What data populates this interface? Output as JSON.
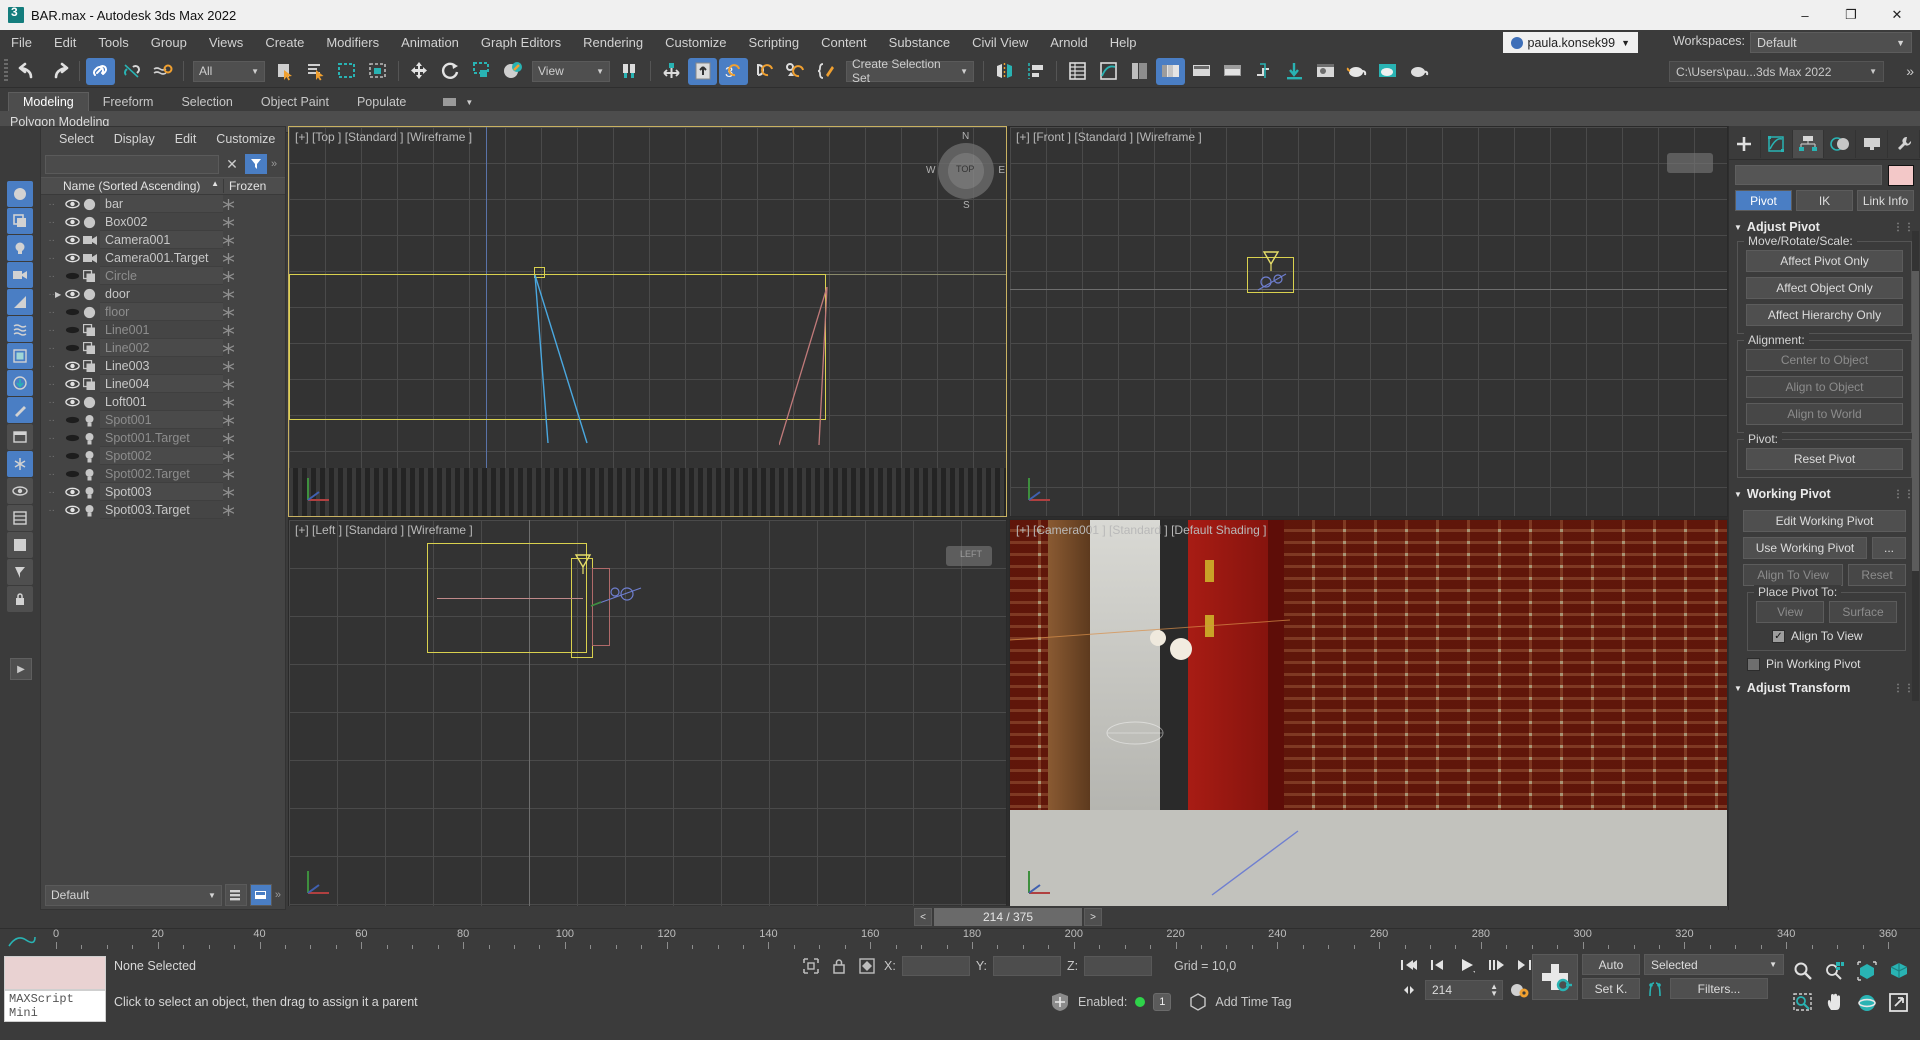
{
  "window": {
    "title": "BAR.max - Autodesk 3ds Max 2022",
    "app_icon": "max-logo-icon",
    "minimize": "–",
    "maximize": "❐",
    "close": "✕"
  },
  "menubar": {
    "items": [
      "File",
      "Edit",
      "Tools",
      "Group",
      "Views",
      "Create",
      "Modifiers",
      "Animation",
      "Graph Editors",
      "Rendering",
      "Customize",
      "Scripting",
      "Content",
      "Substance",
      "Civil View",
      "Arnold",
      "Help"
    ],
    "user": "paula.konsek99",
    "workspaces_label": "Workspaces:",
    "workspace_value": "Default"
  },
  "toolbar": {
    "selection_filter": "All",
    "reference_coordinate": "View",
    "selection_set": "Create Selection Set",
    "project_path": "C:\\Users\\pau...3ds Max 2022",
    "icons": [
      "undo-icon",
      "redo-icon",
      "select-and-link-icon",
      "unlink-selection-icon",
      "bind-to-space-warp-icon",
      "select-object-icon",
      "select-by-name-icon",
      "rectangular-selection-region-icon",
      "window-crossing-icon",
      "select-and-move-icon",
      "select-and-rotate-icon",
      "select-and-scale-icon",
      "select-and-place-icon",
      "use-pivot-point-center-icon",
      "select-and-manipulate-icon",
      "snaps-toggle-icon",
      "angle-snap-icon",
      "percent-snap-icon",
      "spinner-snap-icon",
      "edit-named-selection-sets-icon",
      "mirror-icon",
      "align-icon",
      "layer-explorer-icon",
      "scene-explorer-icon",
      "ribbon-icon",
      "curve-editor-icon",
      "schematic-view-icon",
      "project-folder-icon",
      "material-editor-icon",
      "render-setup-icon",
      "rendered-frame-window-icon",
      "render-production-icon"
    ]
  },
  "ribbon": {
    "tabs": [
      "Modeling",
      "Freeform",
      "Selection",
      "Object Paint",
      "Populate"
    ],
    "active_tab": "Modeling",
    "subtitle": "Polygon Modeling"
  },
  "explorer": {
    "menu": [
      "Select",
      "Display",
      "Edit",
      "Customize"
    ],
    "search_value": "",
    "clear_icon": "close-icon",
    "filter_icon": "funnel-icon",
    "columns": [
      "Name (Sorted Ascending)",
      "Frozen"
    ],
    "sort_arrow": "▲",
    "rows": [
      {
        "name": "bar",
        "type": "geometry",
        "visible": true,
        "hidden": false,
        "expandable": false
      },
      {
        "name": "Box002",
        "type": "geometry",
        "visible": true,
        "hidden": false,
        "expandable": false
      },
      {
        "name": "Camera001",
        "type": "camera",
        "visible": true,
        "hidden": false,
        "expandable": false
      },
      {
        "name": "Camera001.Target",
        "type": "camera",
        "visible": true,
        "hidden": false,
        "expandable": false
      },
      {
        "name": "Circle",
        "type": "shape",
        "visible": false,
        "hidden": true,
        "expandable": false
      },
      {
        "name": "door",
        "type": "geometry",
        "visible": true,
        "hidden": false,
        "expandable": true
      },
      {
        "name": "floor",
        "type": "geometry",
        "visible": false,
        "hidden": true,
        "expandable": false
      },
      {
        "name": "Line001",
        "type": "shape",
        "visible": false,
        "hidden": true,
        "expandable": false
      },
      {
        "name": "Line002",
        "type": "shape",
        "visible": false,
        "hidden": true,
        "expandable": false
      },
      {
        "name": "Line003",
        "type": "shape",
        "visible": true,
        "hidden": false,
        "expandable": false
      },
      {
        "name": "Line004",
        "type": "shape",
        "visible": true,
        "hidden": false,
        "expandable": false
      },
      {
        "name": "Loft001",
        "type": "geometry",
        "visible": true,
        "hidden": false,
        "expandable": false
      },
      {
        "name": "Spot001",
        "type": "light",
        "visible": false,
        "hidden": true,
        "expandable": false
      },
      {
        "name": "Spot001.Target",
        "type": "light",
        "visible": false,
        "hidden": true,
        "expandable": false
      },
      {
        "name": "Spot002",
        "type": "light",
        "visible": false,
        "hidden": true,
        "expandable": false
      },
      {
        "name": "Spot002.Target",
        "type": "light",
        "visible": false,
        "hidden": true,
        "expandable": false
      },
      {
        "name": "Spot003",
        "type": "light",
        "visible": true,
        "hidden": false,
        "expandable": false
      },
      {
        "name": "Spot003.Target",
        "type": "light",
        "visible": true,
        "hidden": false,
        "expandable": false
      }
    ],
    "layer_combo": "Default"
  },
  "viewports": [
    {
      "label": "[+] [Top ] [Standard ] [Wireframe ]",
      "name": "Top",
      "active": true
    },
    {
      "label": "[+] [Front ] [Standard ] [Wireframe ]",
      "name": "Front",
      "active": false
    },
    {
      "label": "[+] [Left ] [Standard ] [Wireframe ]",
      "name": "Left",
      "active": false
    },
    {
      "label": "[+] [Camera001 ] [Standard ] [Default Shading ]",
      "name": "Camera001",
      "active": false
    }
  ],
  "viewcube": {
    "n": "N",
    "s": "S",
    "e": "E",
    "w": "W",
    "top": "TOP",
    "left": "LEFT"
  },
  "command_panel": {
    "tabs": [
      "create-tab",
      "modify-tab",
      "hierarchy-tab",
      "motion-tab",
      "display-tab",
      "utilities-tab"
    ],
    "active_tab": "hierarchy-tab",
    "object_name": "",
    "object_color": "#f3c8c8",
    "mode_buttons": [
      "Pivot",
      "IK",
      "Link Info"
    ],
    "active_mode": "Pivot",
    "adjust_pivot": {
      "title": "Adjust Pivot",
      "move_rotate_scale_label": "Move/Rotate/Scale:",
      "buttons": [
        "Affect Pivot Only",
        "Affect Object Only",
        "Affect Hierarchy Only"
      ],
      "alignment_label": "Alignment:",
      "alignment_buttons": [
        "Center to Object",
        "Align to Object",
        "Align to World"
      ],
      "pivot_label": "Pivot:",
      "reset_button": "Reset Pivot"
    },
    "working_pivot": {
      "title": "Working Pivot",
      "edit_button": "Edit Working Pivot",
      "use_button": "Use Working Pivot",
      "more_button": "...",
      "align_to_view_button": "Align To View",
      "reset_button": "Reset",
      "place_pivot_label": "Place Pivot To:",
      "view_button": "View",
      "surface_button": "Surface",
      "align_checkbox_label": "Align To View",
      "align_checkbox_checked": true,
      "pin_checkbox_label": "Pin Working Pivot",
      "pin_checkbox_checked": false
    },
    "adjust_transform_title": "Adjust Transform"
  },
  "timeslider": {
    "prev": "<",
    "next": ">",
    "value": "214 / 375"
  },
  "trackbar": {
    "ticks": [
      0,
      20,
      40,
      60,
      80,
      100,
      120,
      140,
      160,
      180,
      200,
      220,
      240,
      260,
      280,
      300,
      320,
      340,
      360
    ]
  },
  "statusbar": {
    "maxscript_label": "MAXScript Mini",
    "selection_status": "None Selected",
    "prompt": "Click to select an object, then drag to assign it a parent",
    "lock_icon": "lock-icon",
    "absolute_mode_icon": "absolute-relative-icon",
    "selection_lock_icon": "selection-lock-icon",
    "x_label": "X:",
    "y_label": "Y:",
    "z_label": "Z:",
    "x_value": "",
    "y_value": "",
    "z_value": "",
    "grid_label": "Grid = 10,0",
    "enabled_label": "Enabled:",
    "enabled_state": "on",
    "enabled_count": "1",
    "add_time_tag": "Add Time Tag"
  },
  "animation": {
    "auto_key": "Auto",
    "set_key": "Set K.",
    "key_filters": "Filters...",
    "selection_level": "Selected",
    "current_frame": "214",
    "playback_icons": [
      "go-to-start-icon",
      "previous-frame-icon",
      "play-animation-icon",
      "next-frame-icon",
      "go-to-end-icon",
      "key-mode-toggle-icon",
      "time-configuration-icon"
    ],
    "set_key_big_icon": "set-keys-icon",
    "key_mode_icon": "key-mode-icon"
  },
  "navigation": {
    "icons": [
      "zoom-icon",
      "zoom-all-icon",
      "zoom-extents-icon",
      "zoom-extents-selected-icon",
      "zoom-region-icon",
      "pan-view-icon",
      "orbit-icon",
      "maximize-viewport-toggle-icon"
    ]
  },
  "colors": {
    "accent": "#4a7ec4",
    "active_viewport_border": "#c9b262",
    "teal": "#29b3b3",
    "orange": "#f0a030",
    "enabled_green": "#2fd34a"
  }
}
